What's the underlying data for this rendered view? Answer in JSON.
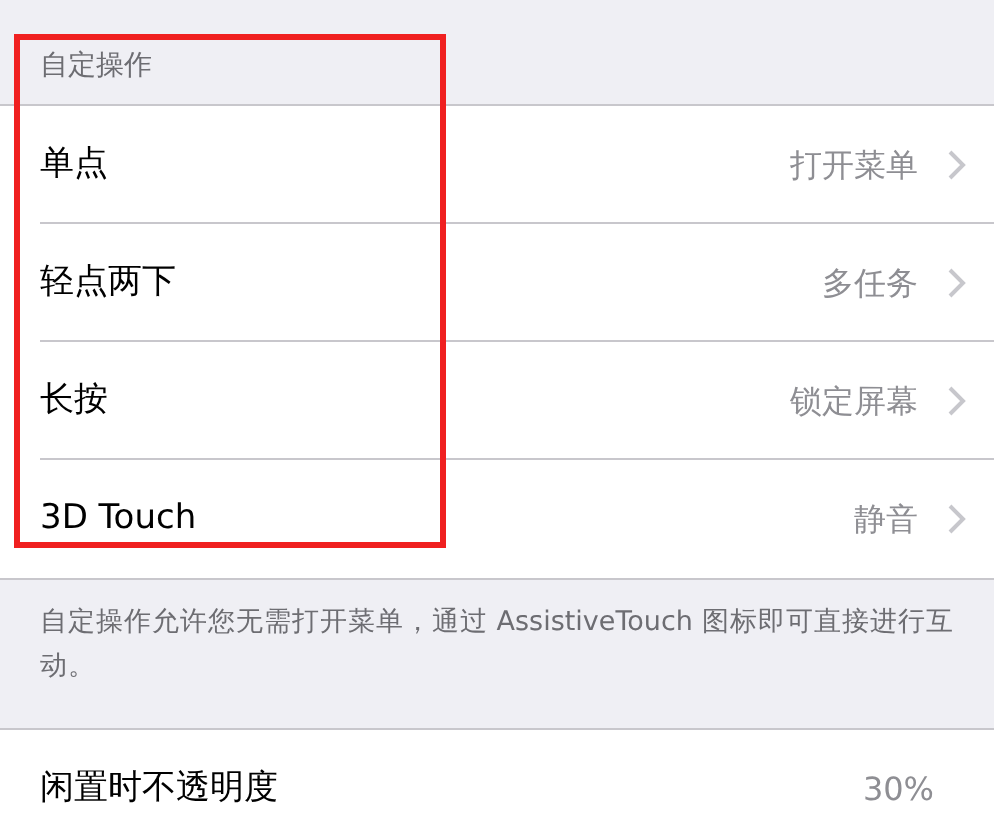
{
  "section_header": "自定操作",
  "actions": [
    {
      "label": "单点",
      "value": "打开菜单"
    },
    {
      "label": "轻点两下",
      "value": "多任务"
    },
    {
      "label": "长按",
      "value": "锁定屏幕"
    },
    {
      "label": "3D Touch",
      "value": "静音"
    }
  ],
  "footer": "自定操作允许您无需打开菜单，通过 AssistiveTouch 图标即可直接进行互动。",
  "idle_opacity": {
    "label": "闲置时不透明度",
    "value": "30%"
  }
}
